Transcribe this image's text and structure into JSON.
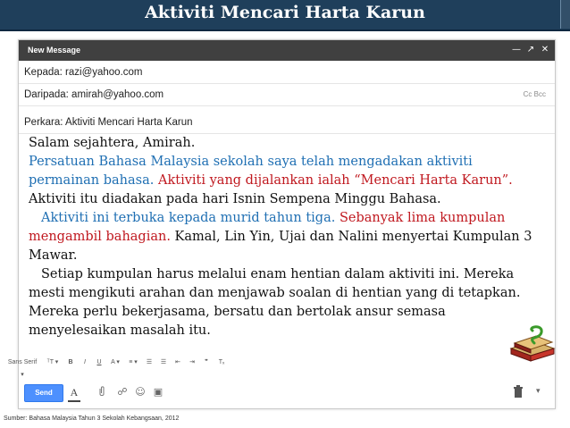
{
  "slide": {
    "title": "Aktiviti Mencari Harta Karun",
    "source": "Sumber: Bahasa Malaysia Tahun 3 Sekolah Kebangsaan, 2012"
  },
  "compose": {
    "header_label": "New Message",
    "to_line": "Kepada:  razi@yahoo.com",
    "from_line": "Daripada:  amirah@yahoo.com",
    "cc_bcc": "Cc  Bcc",
    "subject_line": "Perkara: Aktiviti Mencari Harta Karun"
  },
  "message": {
    "greeting": "Salam sejahtera, Amirah.",
    "s1": "Persatuan Bahasa Malaysia sekolah saya telah mengadakan aktiviti permainan bahasa.",
    "s2": "Aktiviti yang dijalankan ialah “Mencari Harta Karun”.",
    "s3": "Aktiviti itu diadakan pada hari Isnin Sempena Minggu Bahasa.",
    "s4": "Aktiviti ini terbuka kepada murid tahun tiga.",
    "s5": "Sebanyak lima kumpulan mengambil bahagian.",
    "s6": "Kamal, Lin Yin, Ujai dan Nalini menyertai Kumpulan 3 Mawar.",
    "s7": "Setiap kumpulan harus melalui enam hentian dalam aktiviti ini. Mereka mesti mengikuti arahan dan menjawab soalan di hentian yang di tetapkan. Mereka perlu bekerjasama, bersatu dan bertolak ansur semasa menyelesaikan masalah itu."
  },
  "toolbar": {
    "font": "Sans Serif ▾",
    "size": "ᵀT ▾",
    "bold": "B",
    "italic": "I",
    "underline": "U",
    "color": "A ▾",
    "align": "≡ ▾",
    "numbered": "☰",
    "bulleted": "☰",
    "indent_less": "⇤",
    "indent_more": "⇥",
    "quote": "❞",
    "clear": "Tₓ"
  },
  "bottombar": {
    "send_label": "Send",
    "format_label": "A"
  },
  "colors": {
    "title_bar": "#1f3f5b",
    "compose_header": "#404040",
    "send": "#4d90fe",
    "blue_text": "#1f6fb3",
    "red_text": "#c0181f"
  },
  "icons": [
    "minimize-icon",
    "maximize-icon",
    "close-icon",
    "attach-icon",
    "link-icon",
    "emoji-icon",
    "photo-icon",
    "trash-icon",
    "chevron-down-icon",
    "books-icon"
  ]
}
